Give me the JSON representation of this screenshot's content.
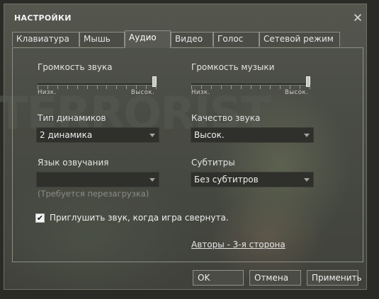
{
  "window": {
    "title": "НАСТРОЙКИ",
    "close_glyph": "✕",
    "background_word": "TERRORIST"
  },
  "tabs": [
    {
      "label": "Клавиатура",
      "active": false
    },
    {
      "label": "Мышь",
      "active": false
    },
    {
      "label": "Аудио",
      "active": true
    },
    {
      "label": "Видео",
      "active": false
    },
    {
      "label": "Голос",
      "active": false
    },
    {
      "label": "Сетевой режим",
      "active": false
    }
  ],
  "audio": {
    "sound_volume": {
      "label": "Громкость звука",
      "min_label": "Низк.",
      "max_label": "Высок.",
      "value": 1.0
    },
    "music_volume": {
      "label": "Громкость музыки",
      "min_label": "Низк.",
      "max_label": "Высок.",
      "value": 1.0
    },
    "speaker_type": {
      "label": "Тип динамиков",
      "value": "2 динамика"
    },
    "sound_quality": {
      "label": "Качество звука",
      "value": "Высок."
    },
    "voice_language": {
      "label": "Язык озвучания",
      "value": "",
      "hint": "(Требуется перезагрузка)"
    },
    "subtitles": {
      "label": "Субтитры",
      "value": "Без субтитров"
    },
    "mute_when_minimized": {
      "label": "Приглушить звук, когда игра свернута.",
      "checked": true,
      "check_glyph": "✔"
    },
    "credits_link": "Авторы - 3-я сторона"
  },
  "buttons": {
    "ok": "OK",
    "cancel": "Отмена",
    "apply": "Применить"
  },
  "colors": {
    "window_bg": "#4b4d45",
    "combo_bg": "#2f302c",
    "border": "#8e8f88",
    "text": "#e4e4e4",
    "hint": "#8c8d86"
  }
}
